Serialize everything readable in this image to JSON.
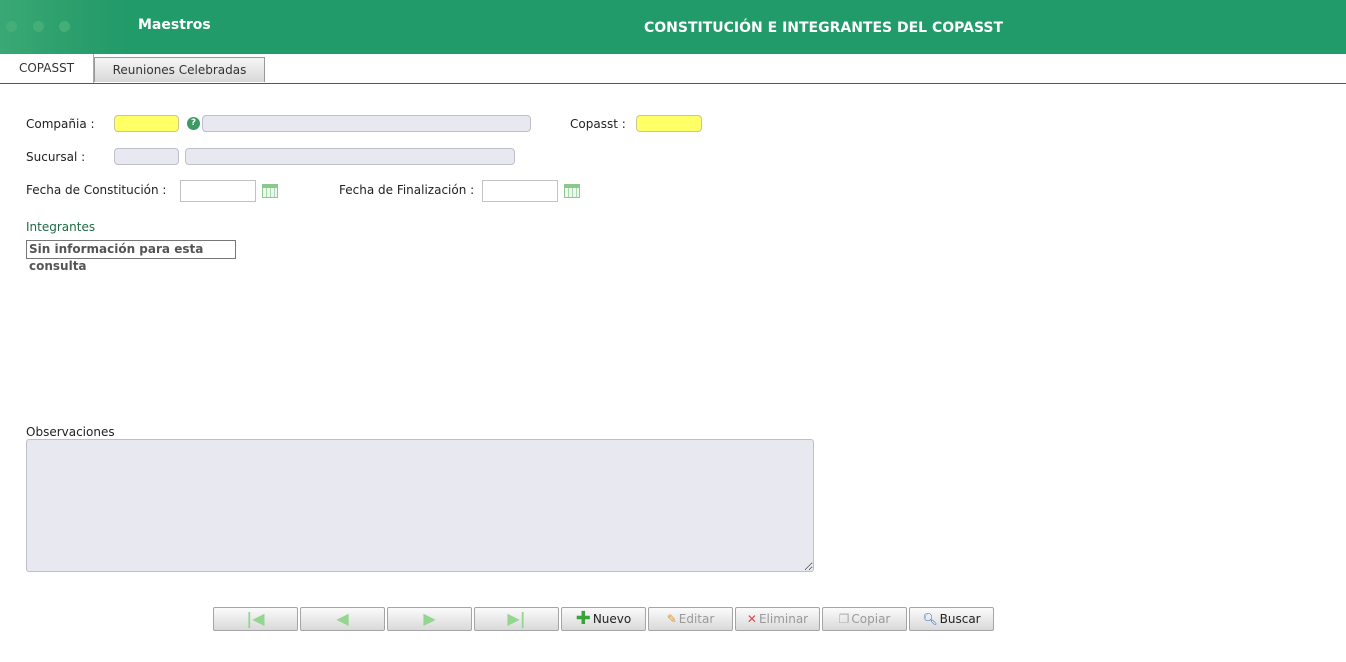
{
  "header": {
    "module": "Maestros",
    "title": "CONSTITUCIÓN E INTEGRANTES DEL COPASST",
    "color": "#219b69"
  },
  "tabs": [
    {
      "label": "COPASST",
      "active": true
    },
    {
      "label": "Reuniones Celebradas",
      "active": false
    }
  ],
  "form": {
    "compania_label": "Compañia :",
    "copasst_label": "Copasst :",
    "sucursal_label": "Sucursal :",
    "fecha_constitucion_label": "Fecha de Constitución :",
    "fecha_finalizacion_label": "Fecha de Finalización :",
    "help_glyph": "?",
    "compania_code": "",
    "compania_name": "",
    "copasst_code": "",
    "sucursal_code": "",
    "sucursal_name": "",
    "fecha_constitucion": "",
    "fecha_finalizacion": ""
  },
  "integrantes": {
    "title": "Integrantes",
    "empty_message": "Sin información para esta consulta"
  },
  "observaciones": {
    "label": "Observaciones",
    "value": ""
  },
  "toolbar": {
    "first_icon": "first-record-icon",
    "prev_icon": "previous-arrow-icon",
    "next_icon": "next-arrow-icon",
    "last_icon": "last-record-icon",
    "nuevo": "Nuevo",
    "editar": "Editar",
    "eliminar": "Eliminar",
    "copiar": "Copiar",
    "buscar": "Buscar"
  },
  "colors": {
    "required_field": "#ffff66",
    "readonly_field": "#e7e8f0",
    "section_title": "#1f6b45"
  }
}
